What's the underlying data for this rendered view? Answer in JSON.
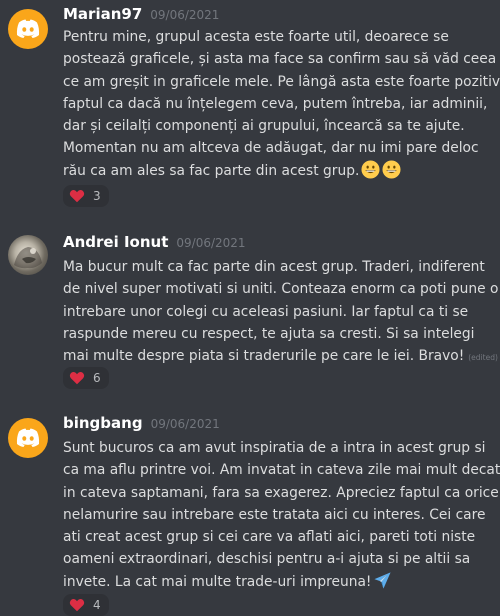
{
  "messages": [
    {
      "username": "Marian97",
      "timestamp": "09/06/2021",
      "avatar": "discord-logo-icon",
      "lines": [
        "Pentru mine, grupul acesta este foarte util, deoarece se",
        "postează graficele, și asta ma face sa confirm sau să văd ceea",
        "ce am greșit in graficele mele. Pe lângă asta este foarte pozitiv",
        "faptul ca dacă nu înțelegem ceva, putem întreba, iar adminii,",
        "dar și ceilalți componenți ai grupului, încearcă sa te ajute.",
        "Momentan nu am altceva de adăugat, dar nu imi pare deloc",
        "rău ca am ales sa fac parte din acest grup."
      ],
      "emojis": [
        "grinning-face-icon",
        "grinning-face-icon"
      ],
      "reaction": {
        "emoji": "red-heart-icon",
        "count": "3"
      }
    },
    {
      "username": "Andrei Ionut",
      "timestamp": "09/06/2021",
      "avatar": "user-photo",
      "lines": [
        "Ma bucur mult ca fac parte din acest grup. Traderi, indiferent",
        "de nivel super motivati si uniti. Conteaza enorm ca poti pune o",
        "intrebare unor colegi cu aceleasi pasiuni. Iar faptul ca ti se",
        "raspunde mereu cu respect, te ajuta sa cresti. Si sa intelegi",
        "mai multe despre piata si traderurile pe care le iei. Bravo!"
      ],
      "edited": "(edited)",
      "reaction": {
        "emoji": "red-heart-icon",
        "count": "6"
      }
    },
    {
      "username": "bingbang",
      "timestamp": "09/06/2021",
      "avatar": "discord-logo-icon",
      "lines": [
        "Sunt bucuros ca am avut inspiratia de a intra in acest grup si",
        "ca ma aflu printre voi. Am invatat in cateva zile mai mult decat",
        "in cateva saptamani, fara sa exagerez. Apreciez faptul ca orice",
        "nelamurire sau intrebare este tratata aici cu interes. Cei care",
        "ati creat acest grup si cei care va aflati aici, pareti toti niste",
        "oameni extraordinari, deschisi pentru a-i ajuta si pe altii sa",
        "invete. La cat mai multe trade-uri impreuna!"
      ],
      "emojis": [
        "airplane-icon"
      ],
      "reaction": {
        "emoji": "red-heart-icon",
        "count": "4"
      }
    }
  ]
}
